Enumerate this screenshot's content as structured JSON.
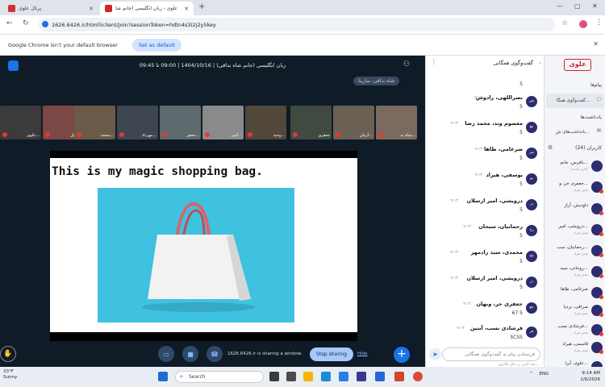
{
  "browser": {
    "tabs": [
      {
        "label": "پرتال علوی"
      },
      {
        "label": "علوی - زبان انگلیسی (جانم شا..."
      }
    ],
    "url": "1626.6426.ir/html5client/join?sessionToken=hdtn4s3i2j2y5key",
    "infobar_text": "Google Chrome isn't your default browser",
    "set_default_label": "Set as default"
  },
  "meeting": {
    "title": "زبان انگلیسی (جانم شاه بداقی) | 1404/10/16 | 09:00 تا 09:45",
    "presenter": "شاه بداقی، سارینا",
    "participants": [
      {
        "name": "علوی..."
      },
      {
        "name": "وکیل..."
      },
      {
        "name": "محمد..."
      },
      {
        "name": "مهرداد..."
      },
      {
        "name": "جعفر..."
      },
      {
        "name": "امیر..."
      },
      {
        "name": "وحید..."
      },
      {
        "name": "جعفری"
      },
      {
        "name": "آرمان..."
      },
      {
        "name": "شاه بد..."
      }
    ],
    "slide_title": "This is my magic shopping bag.",
    "share_status": "1626.6426.ir is sharing a window.",
    "stop_sharing_label": "Stop sharing",
    "hide_label": "Hide"
  },
  "chat": {
    "header": "گفت‌وگوی همگانی",
    "messages": [
      {
        "name": "",
        "time": "",
        "body": "5"
      },
      {
        "name": "نصراللهی، رادوس",
        "time": "۹:۱۲",
        "body": "5"
      },
      {
        "name": "معصوم وند، محمد رضا",
        "time": "۹:۱۲",
        "body": "5"
      },
      {
        "name": "ضرغامی، طاها",
        "time": "۹:۱۲",
        "body": "5"
      },
      {
        "name": "یوسفی، هیراد",
        "time": "۹:۱۲",
        "body": "5"
      },
      {
        "name": "درویشی، امیر ارسلان",
        "time": "۹:۱۲",
        "body": "5"
      },
      {
        "name": "رحمانیان، سبحان",
        "time": "۹:۱۲",
        "body": "5"
      },
      {
        "name": "محمدی، سید رادمهر",
        "time": "۹:۱۲",
        "body": "5"
      },
      {
        "name": "درویشی، امیر ارسلان",
        "time": "۹:۱۲",
        "body": "5"
      },
      {
        "name": "جعفری حر، وبهان",
        "time": "۹:۱۲",
        "body": "67 5"
      },
      {
        "name": "فرشادی نسب، آبتین",
        "time": "۹:۱۲",
        "body": "SCSS"
      }
    ],
    "input_placeholder": "فرستادن پیام به گفت‌وگوی همگانی",
    "typing_status": "چند کاربر در حال نگارش..."
  },
  "sidebar": {
    "logo": "علوی",
    "messages_label": "پیام‌ها",
    "chat_item": "گفت‌وگوی همگا...",
    "notes_label": "یادداشت‌ها",
    "notes_item": "یادداشت‌های ش...",
    "users_label": "کاربران (24)",
    "users": [
      {
        "name": "باقرس، جانم...",
        "sub": "(کاربر کننده)"
      },
      {
        "name": "جعفری حر، و...",
        "sub": "نقش هیراد"
      },
      {
        "name": "داودیش، آراز",
        "sub": ""
      },
      {
        "name": "درویشی، امیر...",
        "sub": "نقش هیراد"
      },
      {
        "name": "رحمانیان، سب...",
        "sub": "نقش هیراد"
      },
      {
        "name": "روحانی، سیه...",
        "sub": "نقش هیراد"
      },
      {
        "name": "ضرغامی، طاها",
        "sub": ""
      },
      {
        "name": "صرافی، برديا",
        "sub": "نقش هیراد"
      },
      {
        "name": "فرشادی نسب...",
        "sub": "نقش هیراد"
      },
      {
        "name": "قاسمی، هیراد",
        "sub": "نقش هیراد"
      },
      {
        "name": "علوی، آیرا...",
        "sub": ""
      }
    ]
  },
  "taskbar": {
    "temp": "33°F",
    "weather": "Sunny",
    "search_label": "Search",
    "lang": "ENG",
    "time": "9:14 AM",
    "date": "1/6/2026"
  }
}
